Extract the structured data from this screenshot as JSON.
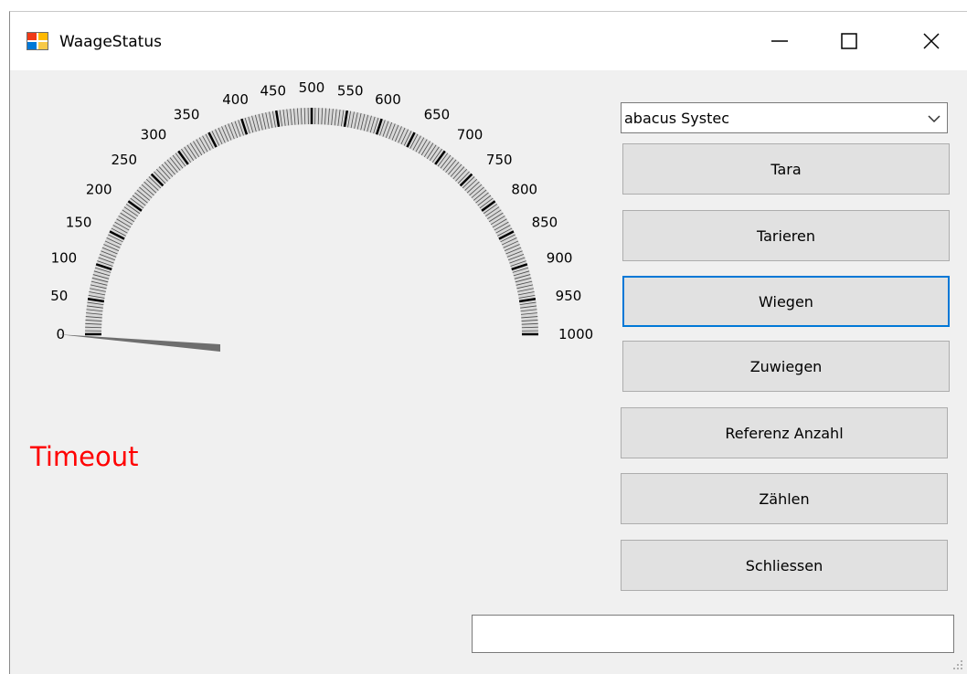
{
  "window": {
    "title": "WaageStatus",
    "icons": {
      "app": "app-window-icon",
      "minimize": "minimize-icon",
      "maximize": "maximize-icon",
      "close": "close-icon"
    }
  },
  "gauge": {
    "min": 0,
    "max": 1000,
    "labels": [
      "0",
      "50",
      "100",
      "150",
      "200",
      "250",
      "300",
      "350",
      "400",
      "450",
      "500",
      "550",
      "600",
      "650",
      "700",
      "750",
      "800",
      "850",
      "900",
      "950",
      "1000"
    ],
    "value": 0
  },
  "status_text": "Timeout",
  "status_color": "#ff0000",
  "scale_select": {
    "value": "abacus Systec"
  },
  "buttons": {
    "tara": "Tara",
    "tarieren": "Tarieren",
    "wiegen": "Wiegen",
    "zuwiegen": "Zuwiegen",
    "referenz": "Referenz Anzahl",
    "zaehlen": "Zählen",
    "schliessen": "Schliessen"
  },
  "output_field": {
    "value": ""
  },
  "colors": {
    "focus": "#0078d7",
    "button_bg": "#e1e1e1",
    "form_bg": "#f0f0f0"
  }
}
